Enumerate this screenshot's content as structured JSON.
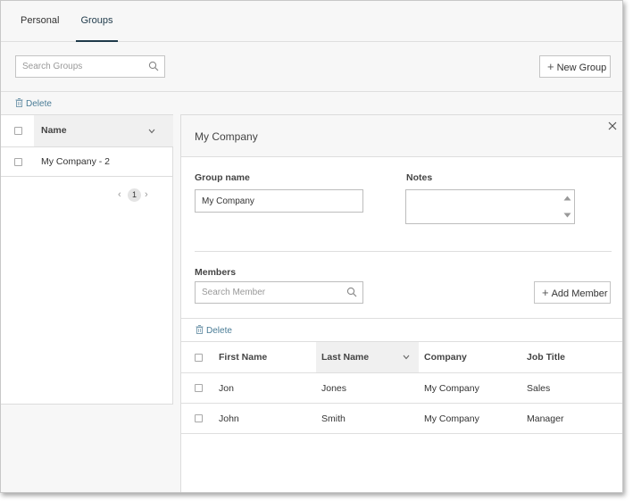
{
  "tabs": [
    {
      "label": "Personal"
    },
    {
      "label": "Groups",
      "active": true
    }
  ],
  "toolbar": {
    "search_placeholder": "Search Groups",
    "new_group_label": "New Group"
  },
  "groups_list": {
    "delete_label": "Delete",
    "column_name": "Name",
    "rows": [
      {
        "name": "My Company - 2"
      }
    ],
    "pagination": {
      "current_page": "1"
    }
  },
  "detail": {
    "title": "My Company",
    "group_name_label": "Group name",
    "group_name_value": "My Company",
    "notes_label": "Notes",
    "notes_value": "",
    "members_label": "Members",
    "search_member_placeholder": "Search Member",
    "add_member_label": "Add Member",
    "delete_label": "Delete",
    "columns": [
      "First Name",
      "Last Name",
      "Company",
      "Job Title"
    ],
    "members": [
      {
        "first_name": "Jon",
        "last_name": "Jones",
        "company": "My Company",
        "job_title": "Sales"
      },
      {
        "first_name": "John",
        "last_name": "Smith",
        "company": "My Company",
        "job_title": "Manager"
      }
    ]
  },
  "colors": {
    "accent": "#1f3a4a",
    "link": "#4a7c96",
    "panel_bg": "#f7f7f7",
    "border": "#dedede"
  },
  "icons": [
    "search-icon",
    "plus-icon",
    "trash-icon",
    "chevron-down-icon",
    "close-icon",
    "chevron-left-icon",
    "chevron-right-icon"
  ]
}
